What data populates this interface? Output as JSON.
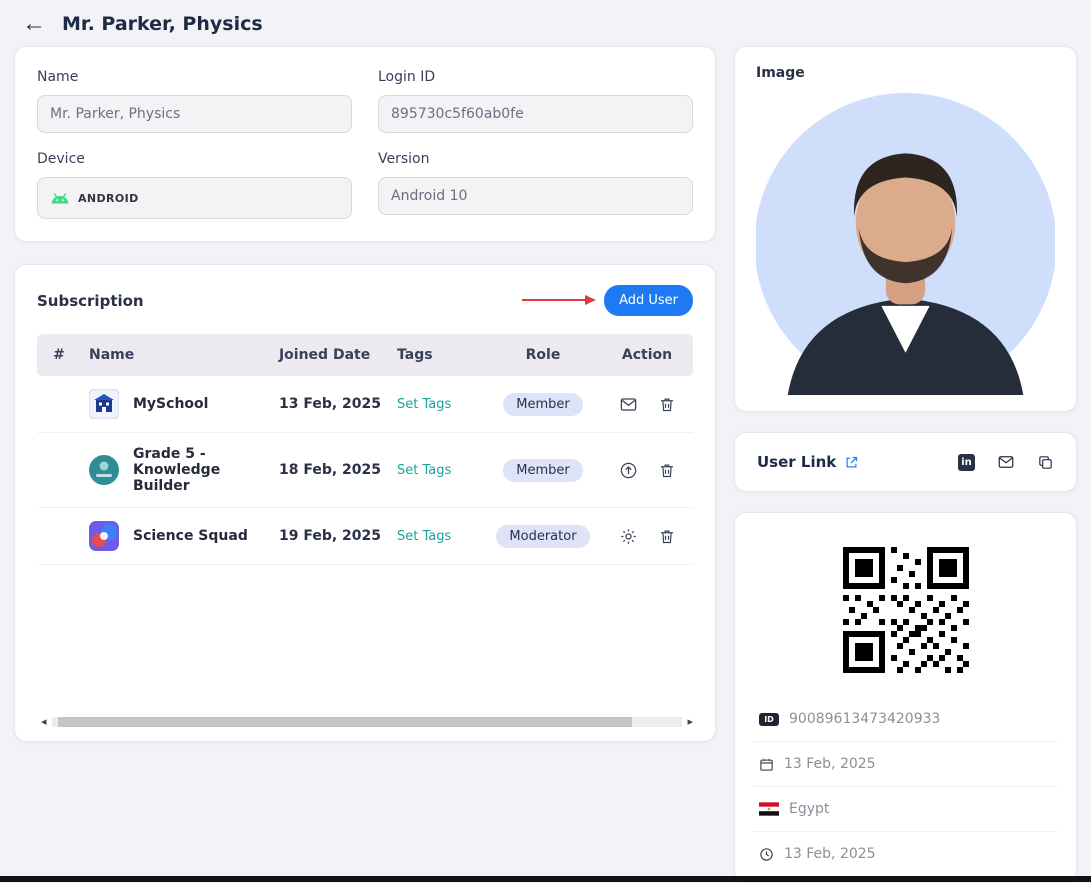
{
  "header": {
    "title": "Mr. Parker, Physics"
  },
  "form": {
    "name": {
      "label": "Name",
      "value": "Mr. Parker, Physics"
    },
    "login_id": {
      "label": "Login ID",
      "value": "895730c5f60ab0fe"
    },
    "device": {
      "label": "Device",
      "value": "ANDROID"
    },
    "version": {
      "label": "Version",
      "value": "Android 10"
    }
  },
  "subscription": {
    "title": "Subscription",
    "add_user_label": "Add User",
    "columns": [
      "#",
      "Name",
      "Joined Date",
      "Tags",
      "Role",
      "Action"
    ],
    "rows": [
      {
        "name": "MySchool",
        "joined_date": "13 Feb, 2025",
        "tags_label": "Set Tags",
        "role": "Member"
      },
      {
        "name": "Grade 5 - Knowledge Builder",
        "joined_date": "18 Feb, 2025",
        "tags_label": "Set Tags",
        "role": "Member"
      },
      {
        "name": "Science Squad",
        "joined_date": "19 Feb, 2025",
        "tags_label": "Set Tags",
        "role": "Moderator"
      }
    ]
  },
  "right_panel": {
    "image_label": "Image",
    "user_link_label": "User Link",
    "qr_info": {
      "user_id": "90089613473420933",
      "joined_date": "13 Feb, 2025",
      "country": "Egypt",
      "last_active": "13 Feb, 2025"
    }
  },
  "colors": {
    "page_bg": "#f3f2f7",
    "accent_blue": "#1d7af2",
    "set_tags_teal": "#18a39b",
    "badge_bg": "#dfe3f7",
    "annotation_red": "#e23b3b",
    "android_green": "#3ddc84"
  }
}
